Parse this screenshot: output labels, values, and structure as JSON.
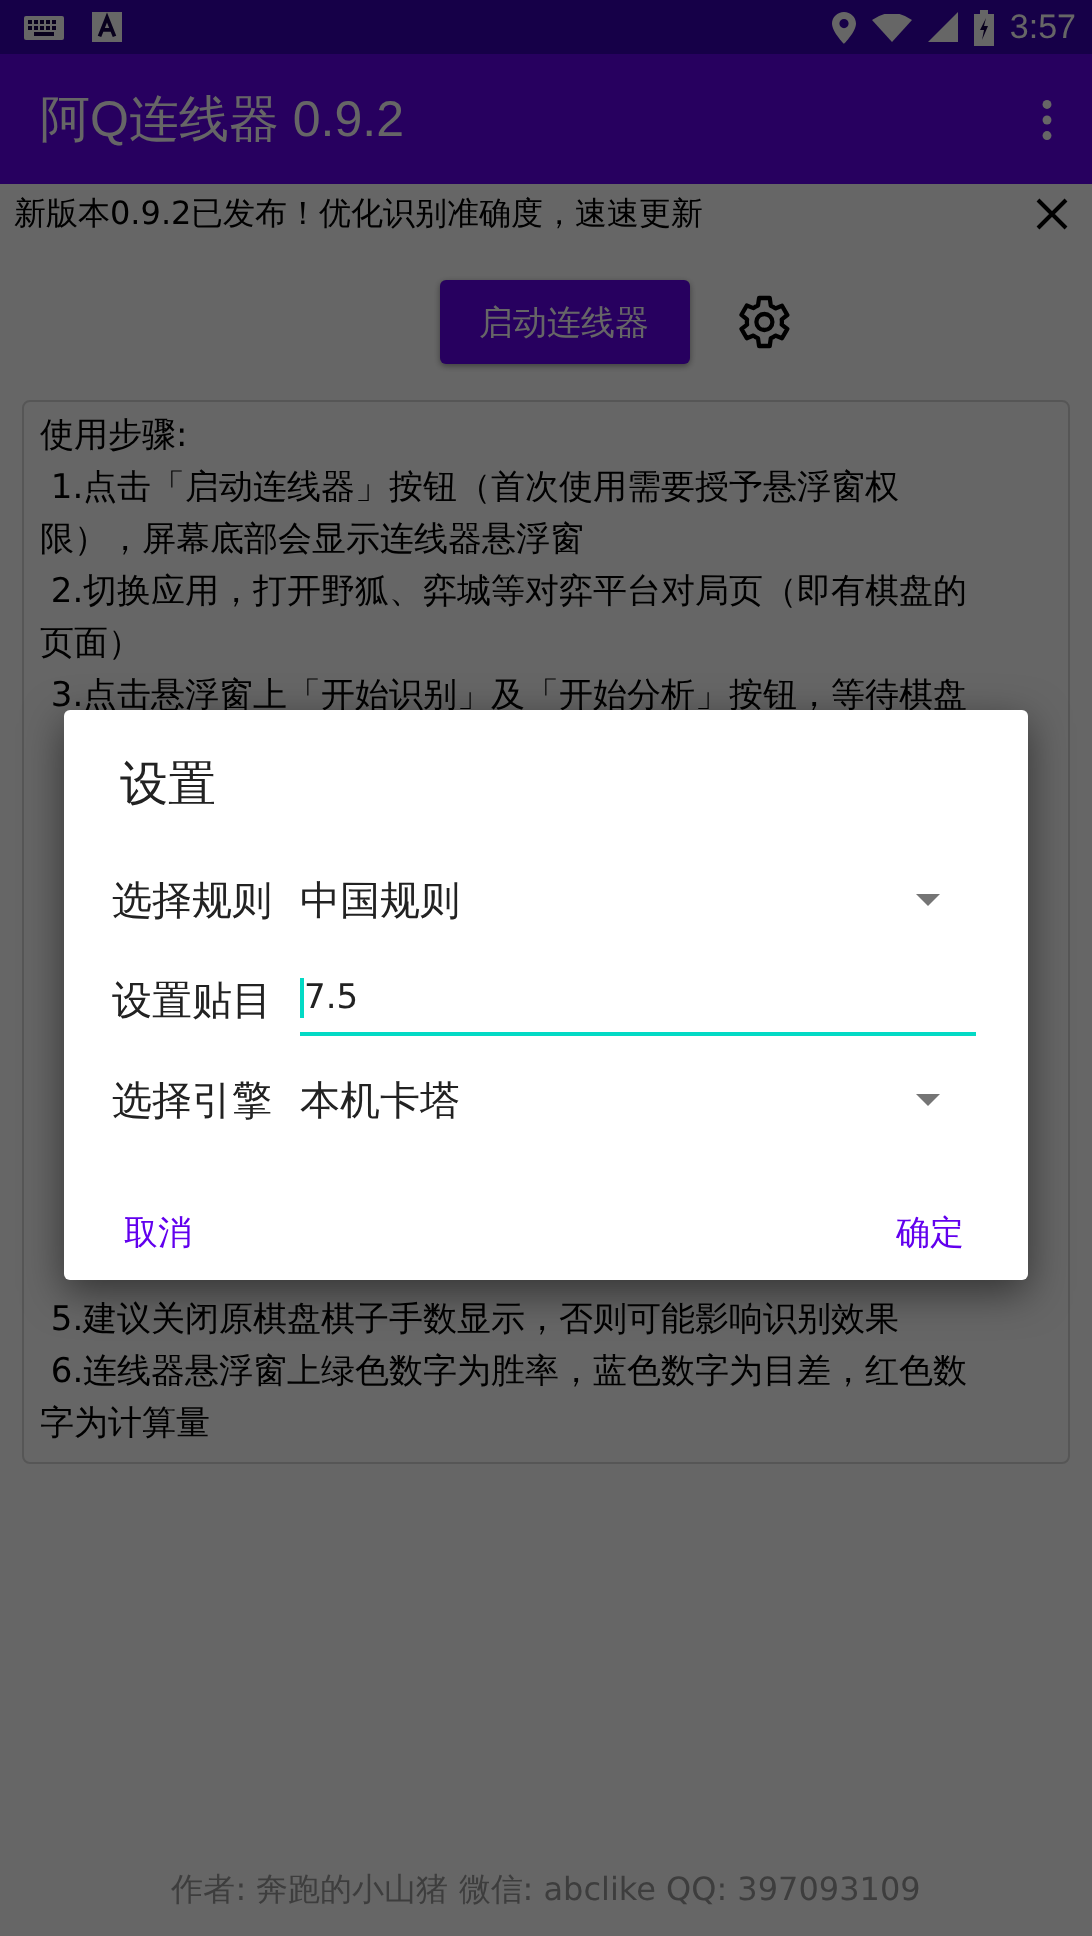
{
  "status_bar": {
    "time": "3:57"
  },
  "app_bar": {
    "title": "阿Q连线器 0.9.2"
  },
  "banner": {
    "text": "新版本0.9.2已发布！优化识别准确度，速速更新"
  },
  "start_button": {
    "label": "启动连线器"
  },
  "instructions": {
    "sections": [
      [
        "使用步骤:",
        " 1.点击「启动连线器」按钮（首次使用需要授予悬浮窗权",
        "限），屏幕底部会显示连线器悬浮窗",
        " 2.切换应用，打开野狐、弈城等对弈平台对局页（即有棋盘的",
        "页面）",
        " 3.点击悬浮窗上「开始识别」及「开始分析」按钮，等待棋盘"
      ],
      [
        " 5.建议关闭原棋盘棋子手数显示，否则可能影响识别效果",
        " 6.连线器悬浮窗上绿色数字为胜率，蓝色数字为目差，红色数",
        "字为计算量"
      ]
    ]
  },
  "footer": {
    "text": "作者: 奔跑的小山猪 微信: abclike QQ: 397093109"
  },
  "dialog": {
    "title": "设置",
    "rows": [
      {
        "kind": "dropdown",
        "label": "选择规则",
        "value": "中国规则"
      },
      {
        "kind": "input",
        "label": "设置贴目",
        "value": "7.5"
      },
      {
        "kind": "dropdown",
        "label": "选择引擎",
        "value": "本机卡塔"
      }
    ],
    "buttons": [
      {
        "label": "取消"
      },
      {
        "label": "确定"
      }
    ]
  }
}
